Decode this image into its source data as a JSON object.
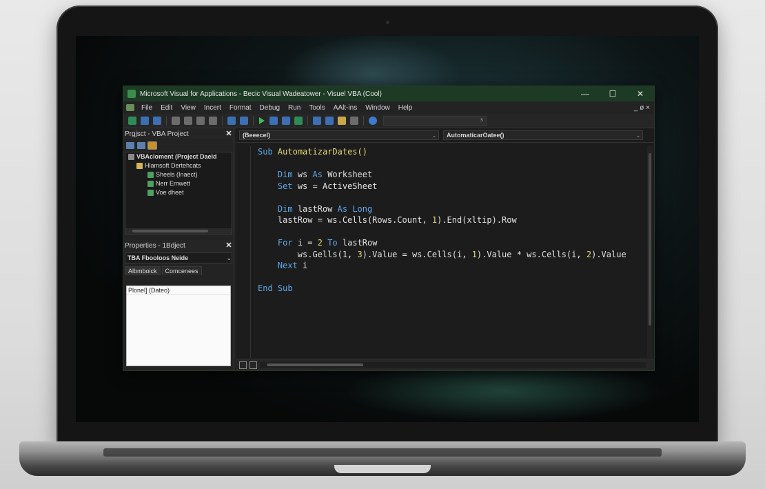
{
  "window": {
    "title": "Microsoft Visual for Applications - Becic Visual Wadeatower - Visuel VBA (Cool)",
    "minimize": "—",
    "maximize": "☐",
    "close": "✕"
  },
  "menu": {
    "items": [
      "File",
      "Edit",
      "View",
      "Incert",
      "Format",
      "Debug",
      "Run",
      "Tools",
      "AAlt-ins",
      "Window",
      "Help"
    ],
    "mdi_controls": "_ ø ×"
  },
  "toolbar": {
    "box_text": "s"
  },
  "project_pane": {
    "title": "Prgjsct - VBA Project",
    "close": "✕",
    "tree": [
      "VBAcloment (Project Daeld",
      "Hlamsoft Dertehcats",
      "Sheels (Inaect)",
      "Nerr Emwett",
      "Voe dheet"
    ]
  },
  "properties_pane": {
    "title": "Properties - 1Bdject",
    "close": "✕",
    "object_combo": "TBA Fbooloos Neide",
    "tabs": [
      "Albmboick",
      "Comcenees"
    ],
    "rows": [
      "Plonel] (Dateo)"
    ]
  },
  "code": {
    "object_combo": "(Beeecel)",
    "proc_combo": "AutomaticarOatee()",
    "lines": {
      "sub": "Sub",
      "sub_name": "AutomatizarDates()",
      "dim1_kw": "Dim",
      "dim1_var": "ws",
      "as1": "As",
      "type1": "Worksheet",
      "set_kw": "Set",
      "set_rest": "ws = ActiveSheet",
      "dim2_kw": "Dim",
      "dim2_var": "lastRow",
      "as2": "As",
      "type2": "Long",
      "lastrow_a": "lastRow = ws.Cells(Rows.Count, ",
      "lastrow_num": "1",
      "lastrow_b": ").End(xltip).Row",
      "for_kw": "For",
      "for_var": "i = ",
      "for_num": "2",
      "to_kw": "To",
      "for_end": "lastRow",
      "body_a": "ws.Gells(1, ",
      "body_num": "3",
      "body_b": ").Value = ws.Cells(i, ",
      "body_num2": "1",
      "body_c": ").Value * ws.Cells(i, ",
      "body_num3": "2",
      "body_d": ").Value",
      "next_kw": "Next",
      "next_var": "i",
      "end_sub": "End Sub"
    }
  }
}
